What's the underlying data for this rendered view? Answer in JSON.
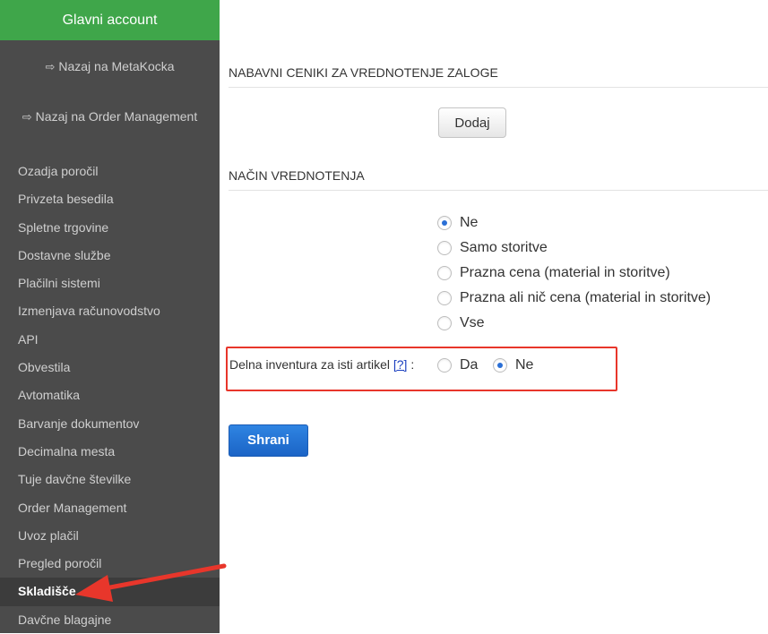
{
  "sidebar": {
    "account_label": "Glavni account",
    "back_links": [
      {
        "label": "Nazaj na MetaKocka",
        "icon": "sign-out-icon"
      },
      {
        "label": "Nazaj na Order Management",
        "icon": "sign-out-icon"
      }
    ],
    "items": [
      {
        "label": "Ozadja poročil"
      },
      {
        "label": "Privzeta besedila"
      },
      {
        "label": "Spletne trgovine"
      },
      {
        "label": "Dostavne službe"
      },
      {
        "label": "Plačilni sistemi"
      },
      {
        "label": "Izmenjava računovodstvo"
      },
      {
        "label": "API"
      },
      {
        "label": "Obvestila"
      },
      {
        "label": "Avtomatika"
      },
      {
        "label": "Barvanje dokumentov"
      },
      {
        "label": "Decimalna mesta"
      },
      {
        "label": "Tuje davčne številke"
      },
      {
        "label": "Order Management"
      },
      {
        "label": "Uvoz plačil"
      },
      {
        "label": "Pregled poročil"
      },
      {
        "label": "Skladišče",
        "active": true
      },
      {
        "label": "Davčne blagajne"
      }
    ]
  },
  "main": {
    "section1_title": "NABAVNI CENIKI ZA VREDNOTENJE ZALOGE",
    "add_button": "Dodaj",
    "section2_title": "NAČIN VREDNOTENJA",
    "valuation_options": [
      {
        "label": "Ne",
        "checked": true
      },
      {
        "label": "Samo storitve",
        "checked": false
      },
      {
        "label": "Prazna cena (material in storitve)",
        "checked": false
      },
      {
        "label": "Prazna ali nič cena (material in storitve)",
        "checked": false
      },
      {
        "label": "Vse",
        "checked": false
      }
    ],
    "partial_inventory": {
      "label": "Delna inventura za isti artikel",
      "help_link": "[?]",
      "colon": ":",
      "options": [
        {
          "label": "Da",
          "checked": false
        },
        {
          "label": "Ne",
          "checked": true
        }
      ]
    },
    "save_button": "Shrani"
  },
  "colors": {
    "account_green": "#3fa64a",
    "sidebar_bg": "#4b4b4b",
    "highlight_red": "#e8362b",
    "primary_blue": "#1b64c6"
  }
}
